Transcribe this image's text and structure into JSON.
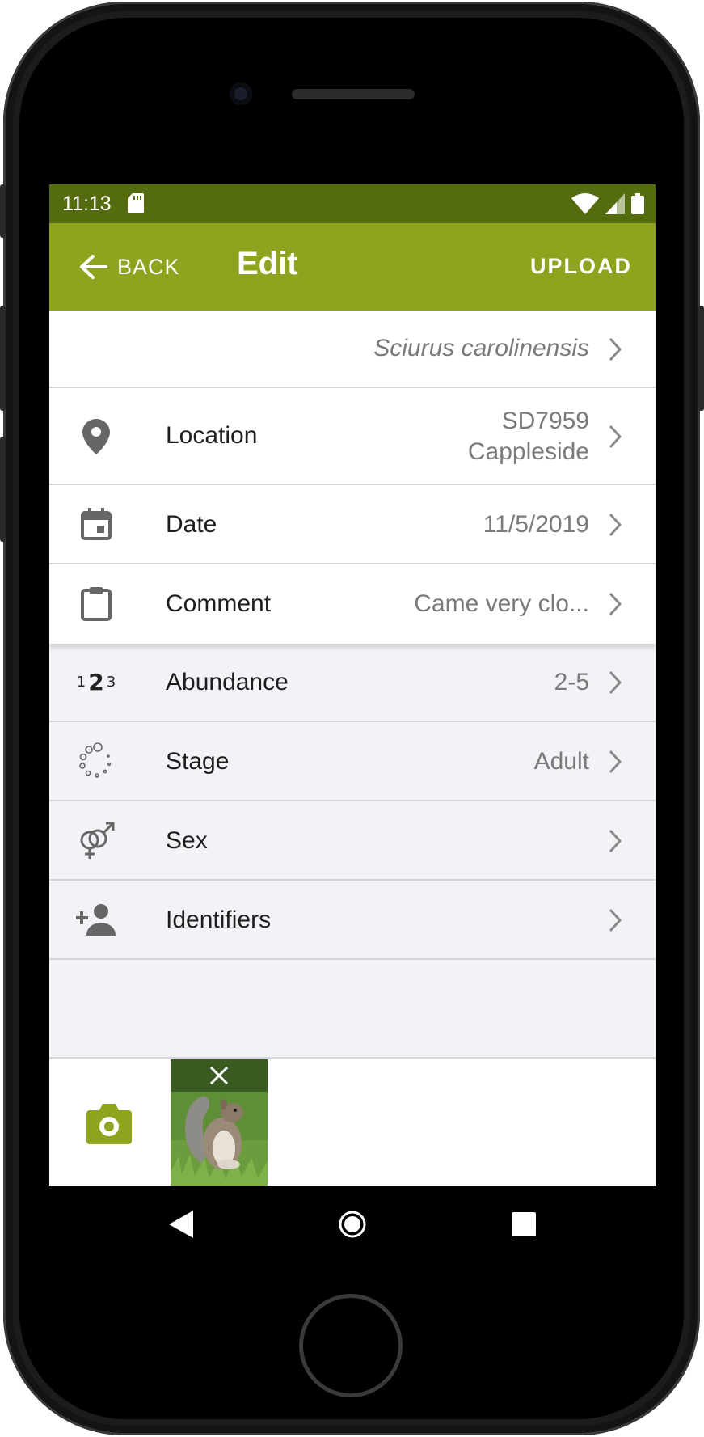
{
  "status_bar": {
    "time": "11:13",
    "icons": [
      "sd-card-icon",
      "wifi-icon",
      "signal-icon",
      "battery-icon"
    ]
  },
  "app_bar": {
    "back_label": "BACK",
    "title": "Edit",
    "upload_label": "UPLOAD"
  },
  "colors": {
    "primary": "#8fa41e",
    "status_bar": "#546b0f",
    "list_bg": "#f2f3f7"
  },
  "species": {
    "value": "Sciurus carolinensis"
  },
  "fields": [
    {
      "label": "Location",
      "value_line1": "SD7959",
      "value_line2": "Cappleside",
      "icon": "location-pin-icon"
    },
    {
      "label": "Date",
      "value": "11/5/2019",
      "icon": "calendar-icon"
    },
    {
      "label": "Comment",
      "value": "Came very clo...",
      "icon": "clipboard-icon"
    }
  ],
  "attributes": [
    {
      "label": "Abundance",
      "value": "2-5",
      "icon": "abundance-icon",
      "icon_text": [
        "1",
        "2",
        "3"
      ]
    },
    {
      "label": "Stage",
      "value": "Adult",
      "icon": "stage-icon"
    },
    {
      "label": "Sex",
      "value": "",
      "icon": "sex-icon"
    },
    {
      "label": "Identifiers",
      "value": "",
      "icon": "add-person-icon"
    }
  ],
  "photos": {
    "count": 1,
    "thumbnail_subject": "grey squirrel"
  },
  "nav": [
    "back-nav-icon",
    "home-nav-icon",
    "recents-nav-icon"
  ]
}
